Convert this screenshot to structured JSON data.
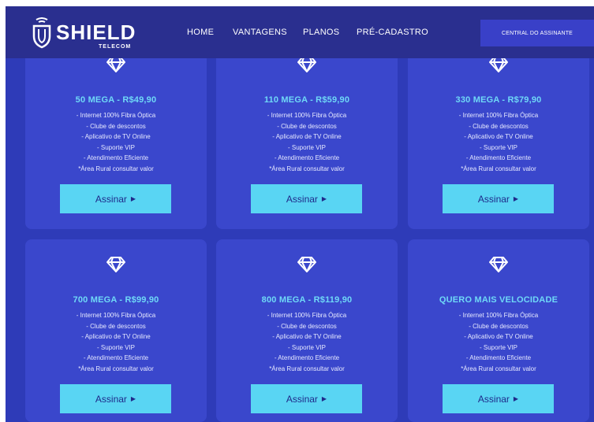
{
  "header": {
    "brand": "SHIELD",
    "brand_sub": "TELECOM",
    "nav": [
      "HOME",
      "VANTAGENS",
      "PLANOS",
      "PRÉ-CADASTRO"
    ],
    "cta_label": "CENTRAL DO ASSINANTE"
  },
  "colors": {
    "accent": "#59d5f3",
    "title": "#6fd9f7",
    "card": "#3a47cc",
    "background": "#2e3bb8"
  },
  "icons": {
    "plan": "diamond-icon",
    "button": "caret-right-icon"
  },
  "plans": [
    {
      "title": "50 MEGA - R$49,90",
      "features": [
        "- Internet 100% Fibra Óptica",
        "- Clube de descontos",
        "- Aplicativo de TV Online",
        "- Suporte VIP",
        "- Atendimento Eficiente",
        "*Área Rural consultar valor"
      ],
      "button": "Assinar"
    },
    {
      "title": "110 MEGA - R$59,90",
      "features": [
        "- Internet 100% Fibra Óptica",
        "- Clube de descontos",
        "- Aplicativo de TV Online",
        "- Suporte VIP",
        "- Atendimento Eficiente",
        "*Área Rural consultar valor"
      ],
      "button": "Assinar"
    },
    {
      "title": "330 MEGA - R$79,90",
      "features": [
        "- Internet 100% Fibra Óptica",
        "- Clube de descontos",
        "- Aplicativo de TV Online",
        "- Suporte VIP",
        "- Atendimento Eficiente",
        "*Área Rural consultar valor"
      ],
      "button": "Assinar"
    },
    {
      "title": "700 MEGA - R$99,90",
      "features": [
        "- Internet 100% Fibra Óptica",
        "- Clube de descontos",
        "- Aplicativo de TV Online",
        "- Suporte VIP",
        "- Atendimento Eficiente",
        "*Área Rural consultar valor"
      ],
      "button": "Assinar"
    },
    {
      "title": "800 MEGA - R$119,90",
      "features": [
        "- Internet 100% Fibra Óptica",
        "- Clube de descontos",
        "- Aplicativo de TV Online",
        "- Suporte VIP",
        "- Atendimento Eficiente",
        "*Área Rural consultar valor"
      ],
      "button": "Assinar"
    },
    {
      "title": "QUERO MAIS VELOCIDADE",
      "features": [
        "- Internet 100% Fibra Óptica",
        "- Clube de descontos",
        "- Aplicativo de TV Online",
        "- Suporte VIP",
        "- Atendimento Eficiente",
        "*Área Rural consultar valor"
      ],
      "button": "Assinar"
    }
  ]
}
